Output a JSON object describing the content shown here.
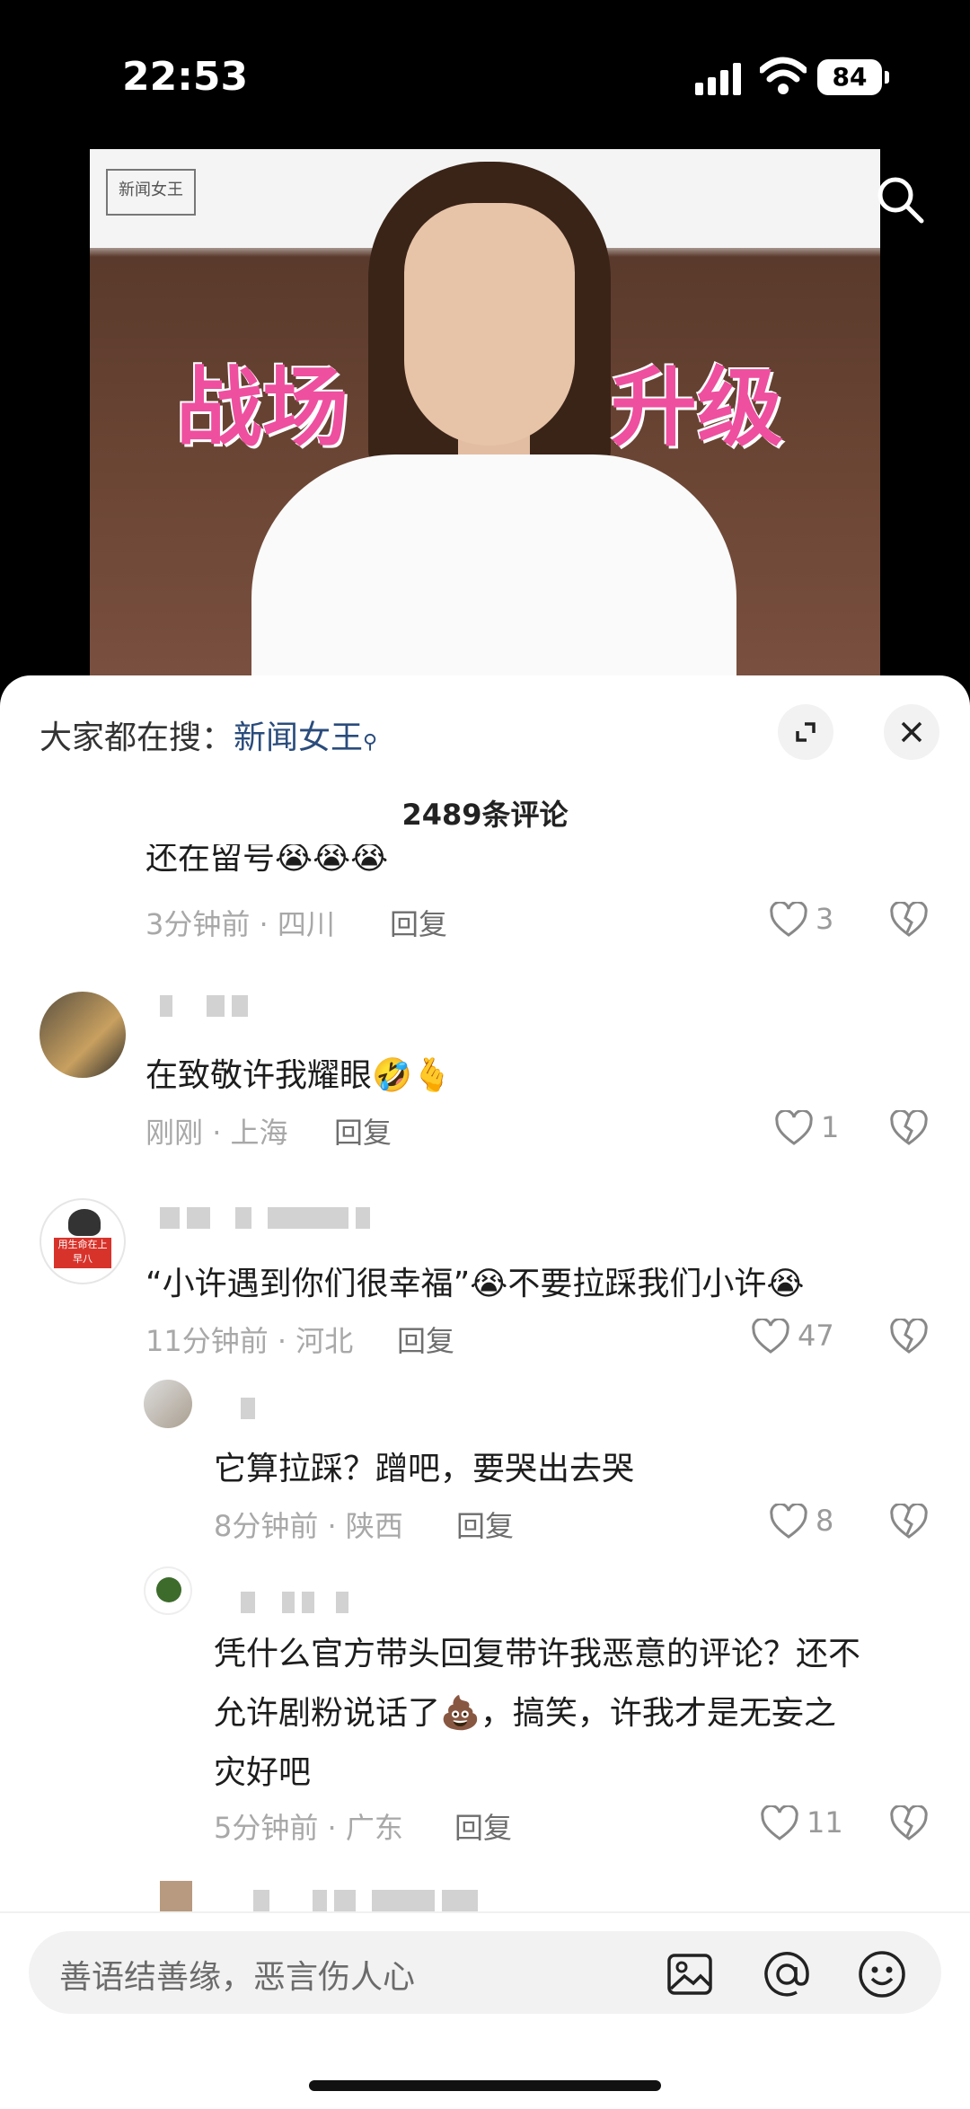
{
  "status": {
    "time": "22:53",
    "battery": "84"
  },
  "video": {
    "logo_text": "新闻女王",
    "overlay_left": "战场",
    "overlay_right": "升级"
  },
  "sheet": {
    "hot_search_prefix": "大家都在搜：",
    "hot_search_keyword": "新闻女王",
    "comment_count": "2489条评论"
  },
  "comments": [
    {
      "text": "还在留号😭😭😭",
      "time": "3分钟前",
      "location": "四川",
      "reply": "回复",
      "likes": "3"
    },
    {
      "text": "在致敬许我耀眼🤣🫰",
      "time": "刚刚",
      "location": "上海",
      "reply": "回复",
      "likes": "1"
    },
    {
      "text": "“小许遇到你们很幸福”😭不要拉踩我们小许😭",
      "time": "11分钟前",
      "location": "河北",
      "reply": "回复",
      "likes": "47",
      "avatar_sign": "用生命在上早八"
    },
    {
      "text": "它算拉踩？蹭吧，要哭出去哭",
      "time": "8分钟前",
      "location": "陕西",
      "reply": "回复",
      "likes": "8"
    },
    {
      "text_line1": "凭什么官方带头回复带许我恶意的评论？还不",
      "text_line2": "允许剧粉说话了💩，搞笑，许我才是无妄之",
      "text_line3": "灾好吧",
      "time": "5分钟前",
      "location": "广东",
      "reply": "回复",
      "likes": "11"
    }
  ],
  "input": {
    "placeholder": "善语结善缘，恶言伤人心"
  },
  "icons": [
    "search-icon",
    "expand-icon",
    "close-icon",
    "heart-icon",
    "dislike-icon",
    "image-icon",
    "at-icon",
    "emoji-icon"
  ],
  "colors": {
    "keyword": "#2a4c7c",
    "overlay_pink": "#ee4f9f"
  }
}
